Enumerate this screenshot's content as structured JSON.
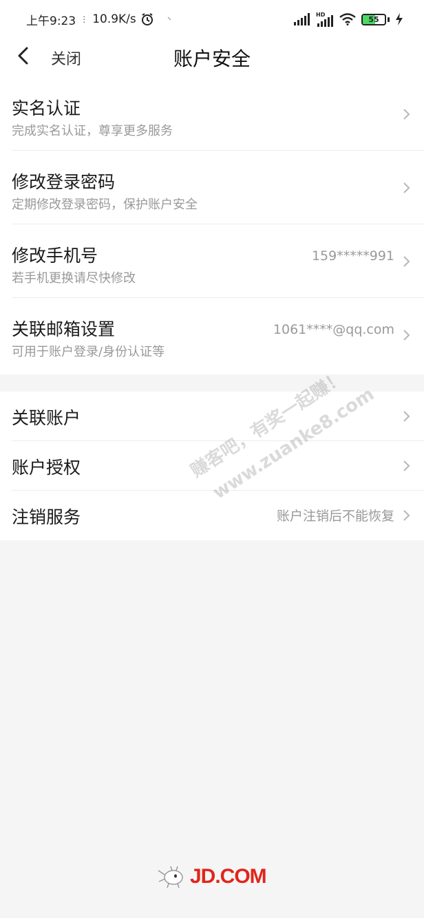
{
  "status_bar": {
    "time": "上午9:23",
    "speed": "10.9K/s",
    "battery": "55",
    "hd_label": "HD"
  },
  "nav": {
    "close_label": "关闭",
    "title": "账户安全"
  },
  "group1": [
    {
      "title": "实名认证",
      "subtitle": "完成实名认证，尊享更多服务",
      "value": ""
    },
    {
      "title": "修改登录密码",
      "subtitle": "定期修改登录密码，保护账户安全",
      "value": ""
    },
    {
      "title": "修改手机号",
      "subtitle": "若手机更换请尽快修改",
      "value": "159*****991"
    },
    {
      "title": "关联邮箱设置",
      "subtitle": "可用于账户登录/身份认证等",
      "value": "1061****@qq.com"
    }
  ],
  "group2": [
    {
      "title": "关联账户",
      "value": ""
    },
    {
      "title": "账户授权",
      "value": ""
    },
    {
      "title": "注销服务",
      "value": "账户注销后不能恢复"
    }
  ],
  "watermark": {
    "line1": "赚客吧，有奖一起赚！",
    "line2": "www.zuanke8.com"
  },
  "footer": {
    "logo_text": "JD.COM"
  },
  "colors": {
    "brand_red": "#e1251b",
    "background": "#f5f5f5",
    "battery_green": "#4cd964"
  },
  "battery_level": 0.55
}
